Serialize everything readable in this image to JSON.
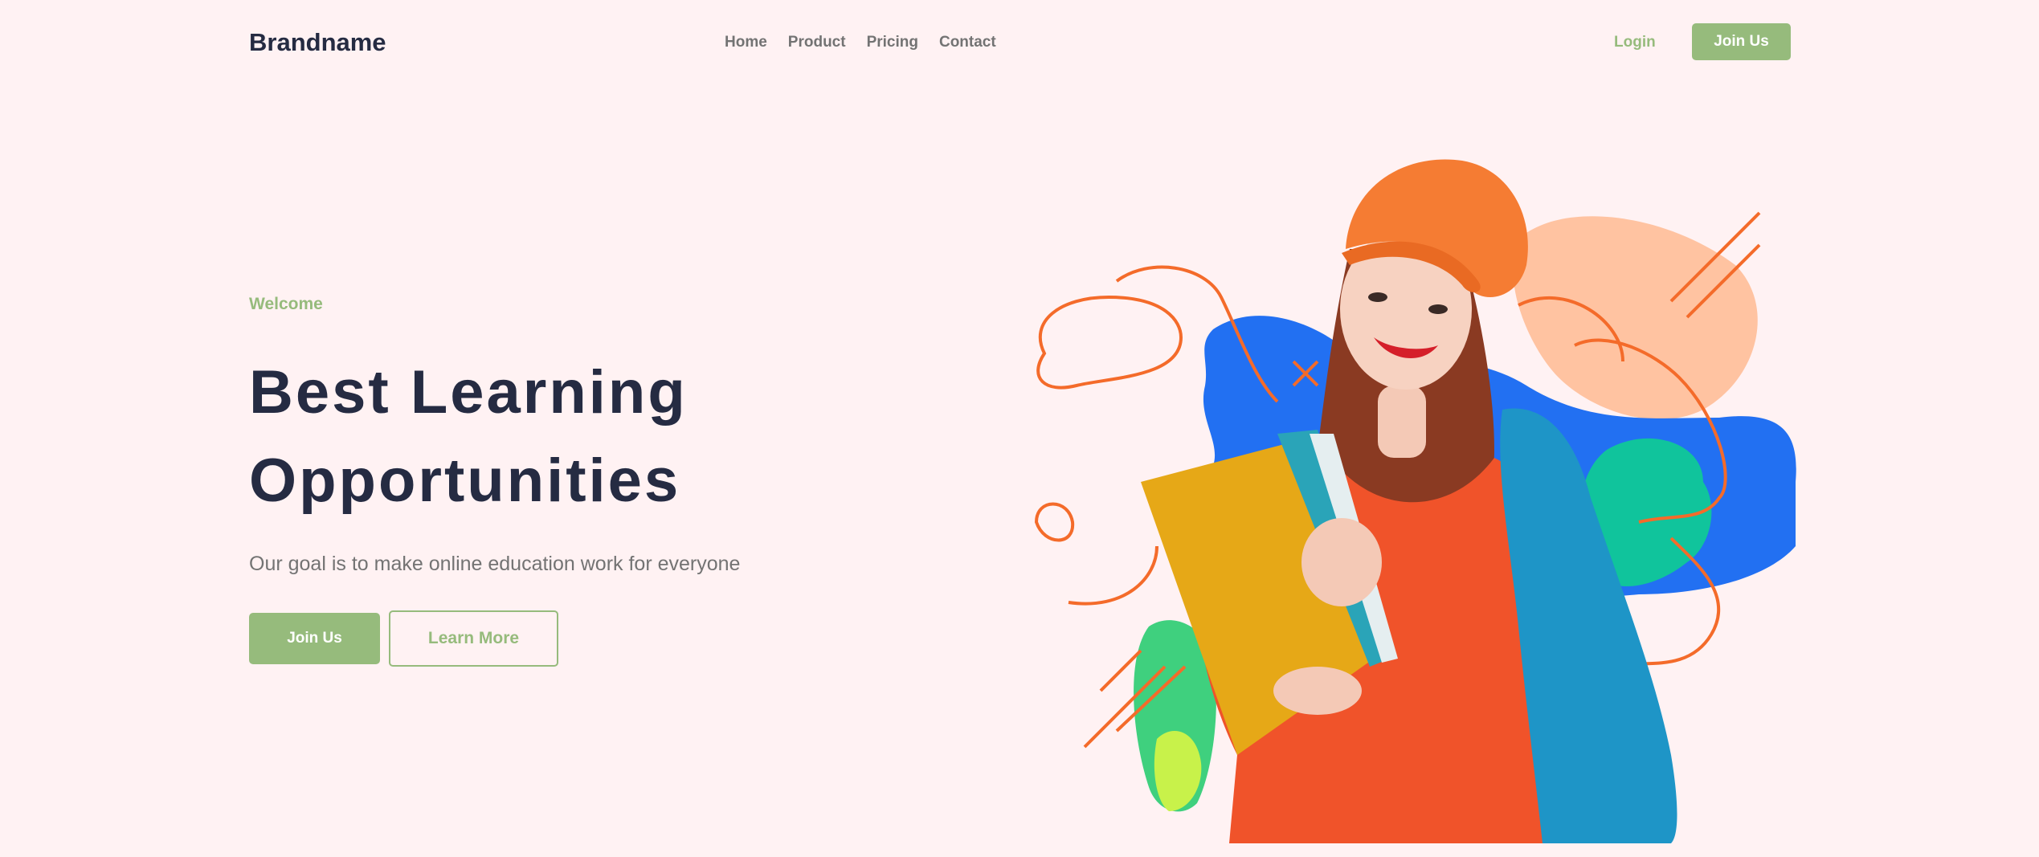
{
  "header": {
    "brand": "Brandname",
    "nav": [
      "Home",
      "Product",
      "Pricing",
      "Contact"
    ],
    "login_label": "Login",
    "join_label": "Join Us"
  },
  "hero": {
    "eyebrow": "Welcome",
    "title_line1": "Best Learning",
    "title_line2": "Opportunities",
    "subtitle": "Our goal is to make online education work for everyone",
    "primary_cta": "Join Us",
    "secondary_cta": "Learn More"
  },
  "colors": {
    "background": "#FFF2F3",
    "accent": "#96BB7C",
    "heading": "#252B42",
    "muted": "#737373"
  },
  "illustration": {
    "subject": "student-with-folders-photo",
    "icons": [
      "blob-shapes",
      "squiggle-lines"
    ]
  }
}
